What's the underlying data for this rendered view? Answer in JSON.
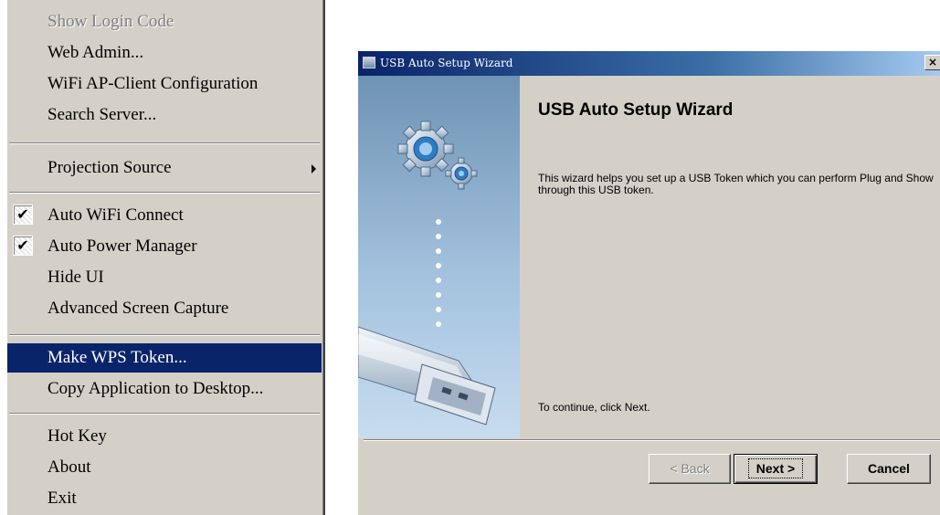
{
  "menu": {
    "items": [
      {
        "label": "Show Login Code",
        "state": "disabled"
      },
      {
        "label": "Web Admin..."
      },
      {
        "label": "WiFi AP-Client Configuration"
      },
      {
        "label": "Search Server..."
      },
      {
        "label": "Projection Source",
        "submenu": true
      },
      {
        "label": "Auto WiFi Connect",
        "checked": true
      },
      {
        "label": "Auto Power Manager",
        "checked": true
      },
      {
        "label": "Hide UI"
      },
      {
        "label": "Advanced Screen Capture"
      },
      {
        "label": "Make WPS Token...",
        "state": "highlighted"
      },
      {
        "label": "Copy Application to Desktop..."
      },
      {
        "label": "Hot Key"
      },
      {
        "label": "About"
      },
      {
        "label": "Exit"
      }
    ],
    "check_glyph": "✔",
    "highlight_color": "#0a246a"
  },
  "wizard": {
    "window_title": "USB Auto Setup Wizard",
    "close_glyph": "×",
    "heading": "USB Auto Setup Wizard",
    "description": "This wizard helps you set up a USB Token which you can perform Plug and Show through this USB token.",
    "continue_text": "To continue, click Next.",
    "buttons": {
      "back": "< Back",
      "next": "Next >",
      "cancel": "Cancel"
    },
    "illustration": {
      "icons": [
        "gears-icon",
        "usb-drive-icon"
      ]
    }
  }
}
